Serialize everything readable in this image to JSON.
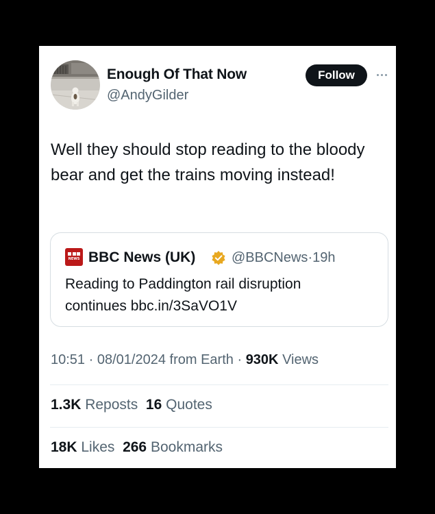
{
  "author": {
    "name": "Enough Of That Now",
    "handle": "@AndyGilder"
  },
  "follow_label": "Follow",
  "more_icon": "more-horizontal-icon",
  "tweet_text": "Well they should stop reading to the bloody bear and get the trains moving instead!",
  "quoted": {
    "logo_text": "NEWS",
    "name": "BBC News (UK)",
    "badge_color": "#e8a820",
    "handle": "@BBCNews",
    "separator": "·",
    "age": "19h",
    "text": "Reading to Paddington rail disruption continues bbc.in/3SaVO1V"
  },
  "meta": {
    "time": "10:51",
    "sep1": "·",
    "date": "08/01/2024",
    "source": "from Earth",
    "sep2": "·",
    "views_count": "930K",
    "views_label": "Views"
  },
  "stats": {
    "reposts_count": "1.3K",
    "reposts_label": "Reposts",
    "quotes_count": "16",
    "quotes_label": "Quotes",
    "likes_count": "18K",
    "likes_label": "Likes",
    "bookmarks_count": "266",
    "bookmarks_label": "Bookmarks"
  }
}
